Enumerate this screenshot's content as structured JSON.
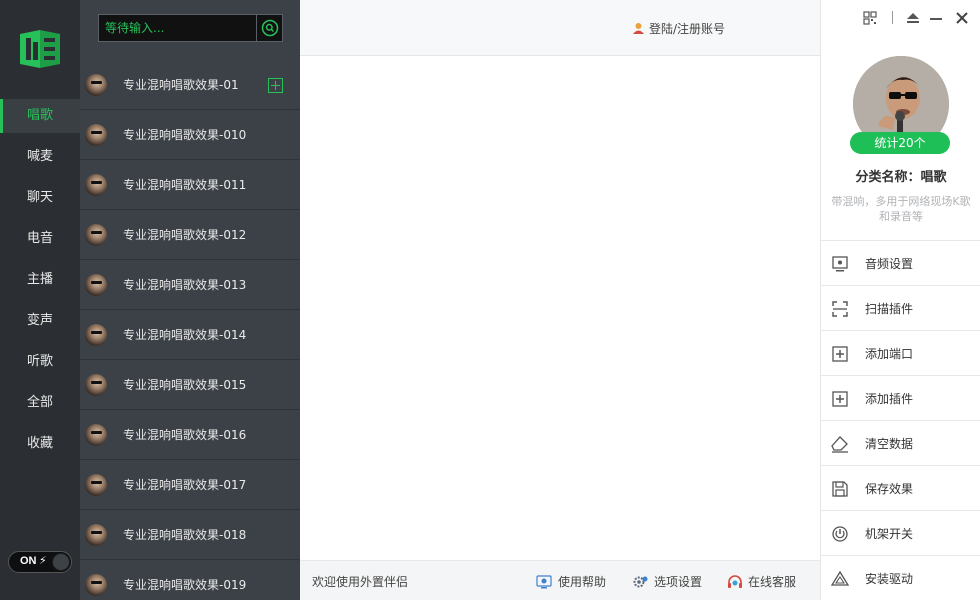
{
  "nav": {
    "items": [
      {
        "label": "唱歌",
        "active": true
      },
      {
        "label": "喊麦",
        "active": false
      },
      {
        "label": "聊天",
        "active": false
      },
      {
        "label": "电音",
        "active": false
      },
      {
        "label": "主播",
        "active": false
      },
      {
        "label": "变声",
        "active": false
      },
      {
        "label": "听歌",
        "active": false
      },
      {
        "label": "全部",
        "active": false
      },
      {
        "label": "收藏",
        "active": false
      }
    ],
    "toggle_label": "ON",
    "toggle_bolt": "⚡"
  },
  "search": {
    "placeholder": "等待输入..."
  },
  "presets": [
    "专业混响唱歌效果-01",
    "专业混响唱歌效果-010",
    "专业混响唱歌效果-011",
    "专业混响唱歌效果-012",
    "专业混响唱歌效果-013",
    "专业混响唱歌效果-014",
    "专业混响唱歌效果-015",
    "专业混响唱歌效果-016",
    "专业混响唱歌效果-017",
    "专业混响唱歌效果-018",
    "专业混响唱歌效果-019"
  ],
  "header": {
    "login_label": "登陆/注册账号"
  },
  "footer": {
    "welcome": "欢迎使用外置伴侣",
    "help": "使用帮助",
    "options": "选项设置",
    "support": "在线客服"
  },
  "panel": {
    "count_badge": "统计20个",
    "category_name": "分类名称：唱歌",
    "category_desc": "带混响，多用于网络现场K歌和录音等",
    "menu": [
      {
        "label": "音频设置",
        "icon": "monitor-icon"
      },
      {
        "label": "扫描插件",
        "icon": "scan-icon"
      },
      {
        "label": "添加端口",
        "icon": "add-port-icon"
      },
      {
        "label": "添加插件",
        "icon": "add-plugin-icon"
      },
      {
        "label": "清空数据",
        "icon": "eraser-icon"
      },
      {
        "label": "保存效果",
        "icon": "save-icon"
      },
      {
        "label": "机架开关",
        "icon": "power-icon"
      },
      {
        "label": "安装驱动",
        "icon": "drive-icon"
      }
    ]
  },
  "colors": {
    "accent": "#27c15a",
    "nav_bg": "#2b2f33",
    "list_bg": "#3b4146"
  }
}
